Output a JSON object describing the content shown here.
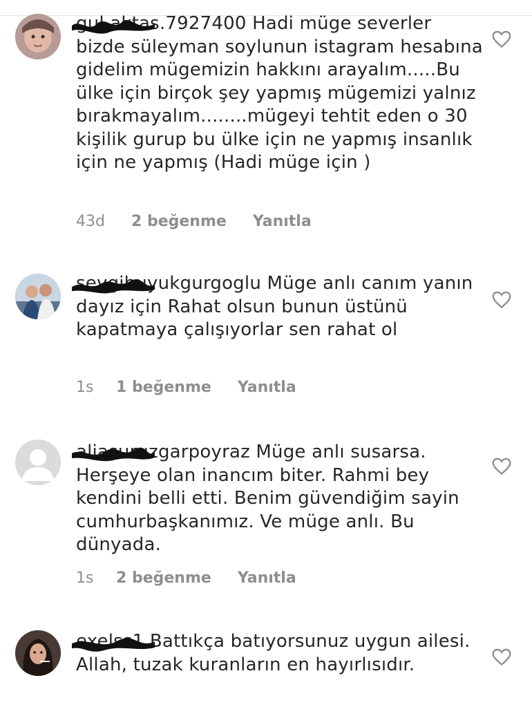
{
  "comments": [
    {
      "username": "gul.aktas.7927400",
      "text": "Hadi müge severler bizde süleyman soylunun istagram hesabına gidelim mügemizin hakkını arayalım.....Bu ülke için birçok şey yapmış mügemizi yalnız bırakmayalım........mügeyi tehtit eden o 30 kişilik gurup bu ülke için ne yapmış insanlık için ne yapmış (Hadi müge için )",
      "time": "43d",
      "likes": "2 beğenme",
      "reply": "Yanıtla",
      "avatar_icon": "avatar-photo-child-icon"
    },
    {
      "username": "sevgibuyukgurgoglu",
      "text": "Müge anlı canım yanın dayız için Rahat olsun bunun üstünü kapatmaya çalışıyorlar sen rahat ol",
      "time": "1s",
      "likes": "1 beğenme",
      "reply": "Yanıtla",
      "avatar_icon": "avatar-photo-couple-icon"
    },
    {
      "username": "aliasuruzgarpoyraz",
      "text": "Müge anlı susarsa. Herşeye olan inancım biter. Rahmi bey kendini belli etti. Benim güvendiğim sayin cumhurbaşkanımız. Ve müge anlı. Bu dünyada.",
      "time": "1s",
      "likes": "2 beğenme",
      "reply": "Yanıtla",
      "avatar_icon": "default-avatar-icon"
    },
    {
      "username": "exelss1",
      "text": "Battıkça batıyorsunuz uygun ailesi. Allah, tuzak kuranların en hayırlısıdır.",
      "time": "",
      "likes": "",
      "reply": "",
      "avatar_icon": "avatar-photo-woman-icon"
    }
  ],
  "colors": {
    "text": "#262626",
    "meta": "#8e8e8e",
    "redaction": "#111111",
    "heart": "#8e8e8e"
  }
}
